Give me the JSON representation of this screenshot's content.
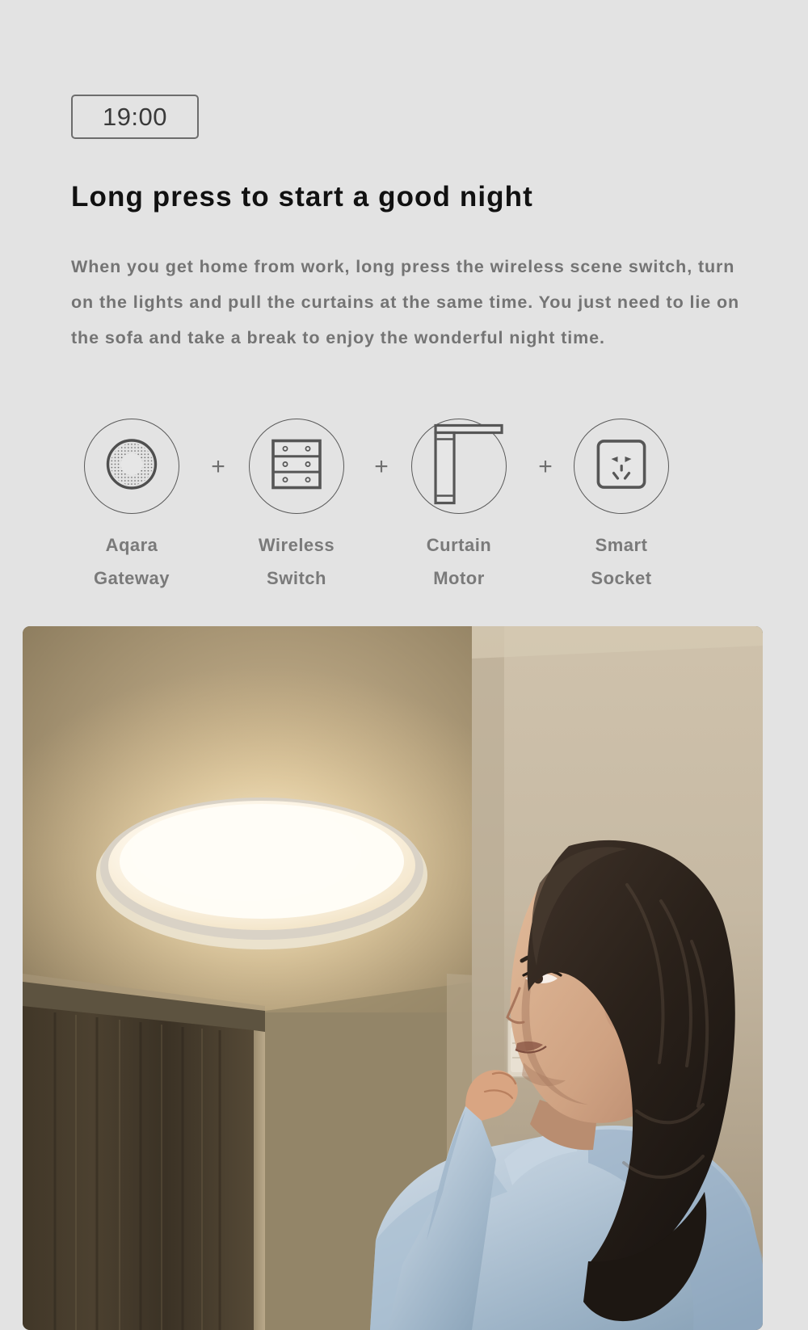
{
  "badge": {
    "time": "19:00",
    "icon": "clock-time-badge"
  },
  "headline": "Long press to start a good night",
  "body": "When you get home from work, long press the wireless scene switch, turn on the lights and pull the curtains at the same time. You just need to lie on the sofa and take a break to enjoy the wonderful night time.",
  "devices": [
    {
      "icon": "aqara-gateway-icon",
      "line1": "Aqara",
      "line2": "Gateway"
    },
    {
      "icon": "wireless-switch-icon",
      "line1": "Wireless",
      "line2": "Switch"
    },
    {
      "icon": "curtain-motor-icon",
      "line1": "Curtain",
      "line2": "Motor"
    },
    {
      "icon": "smart-socket-icon",
      "line1": "Smart",
      "line2": "Socket"
    }
  ],
  "separators": [
    "+",
    "+",
    "+"
  ],
  "photo": {
    "name": "woman-pressing-wall-switch-under-ceiling-light",
    "alt": "Woman in a light blue blouse pressing a wall switch in a warmly lit room with a round ceiling light"
  },
  "colors": {
    "background": "#e3e3e3",
    "headline": "#111111",
    "body_text": "#747474",
    "label_text": "#7a7a7a",
    "icon_stroke": "#5a5a5a",
    "badge_border": "#6d6d6d"
  }
}
